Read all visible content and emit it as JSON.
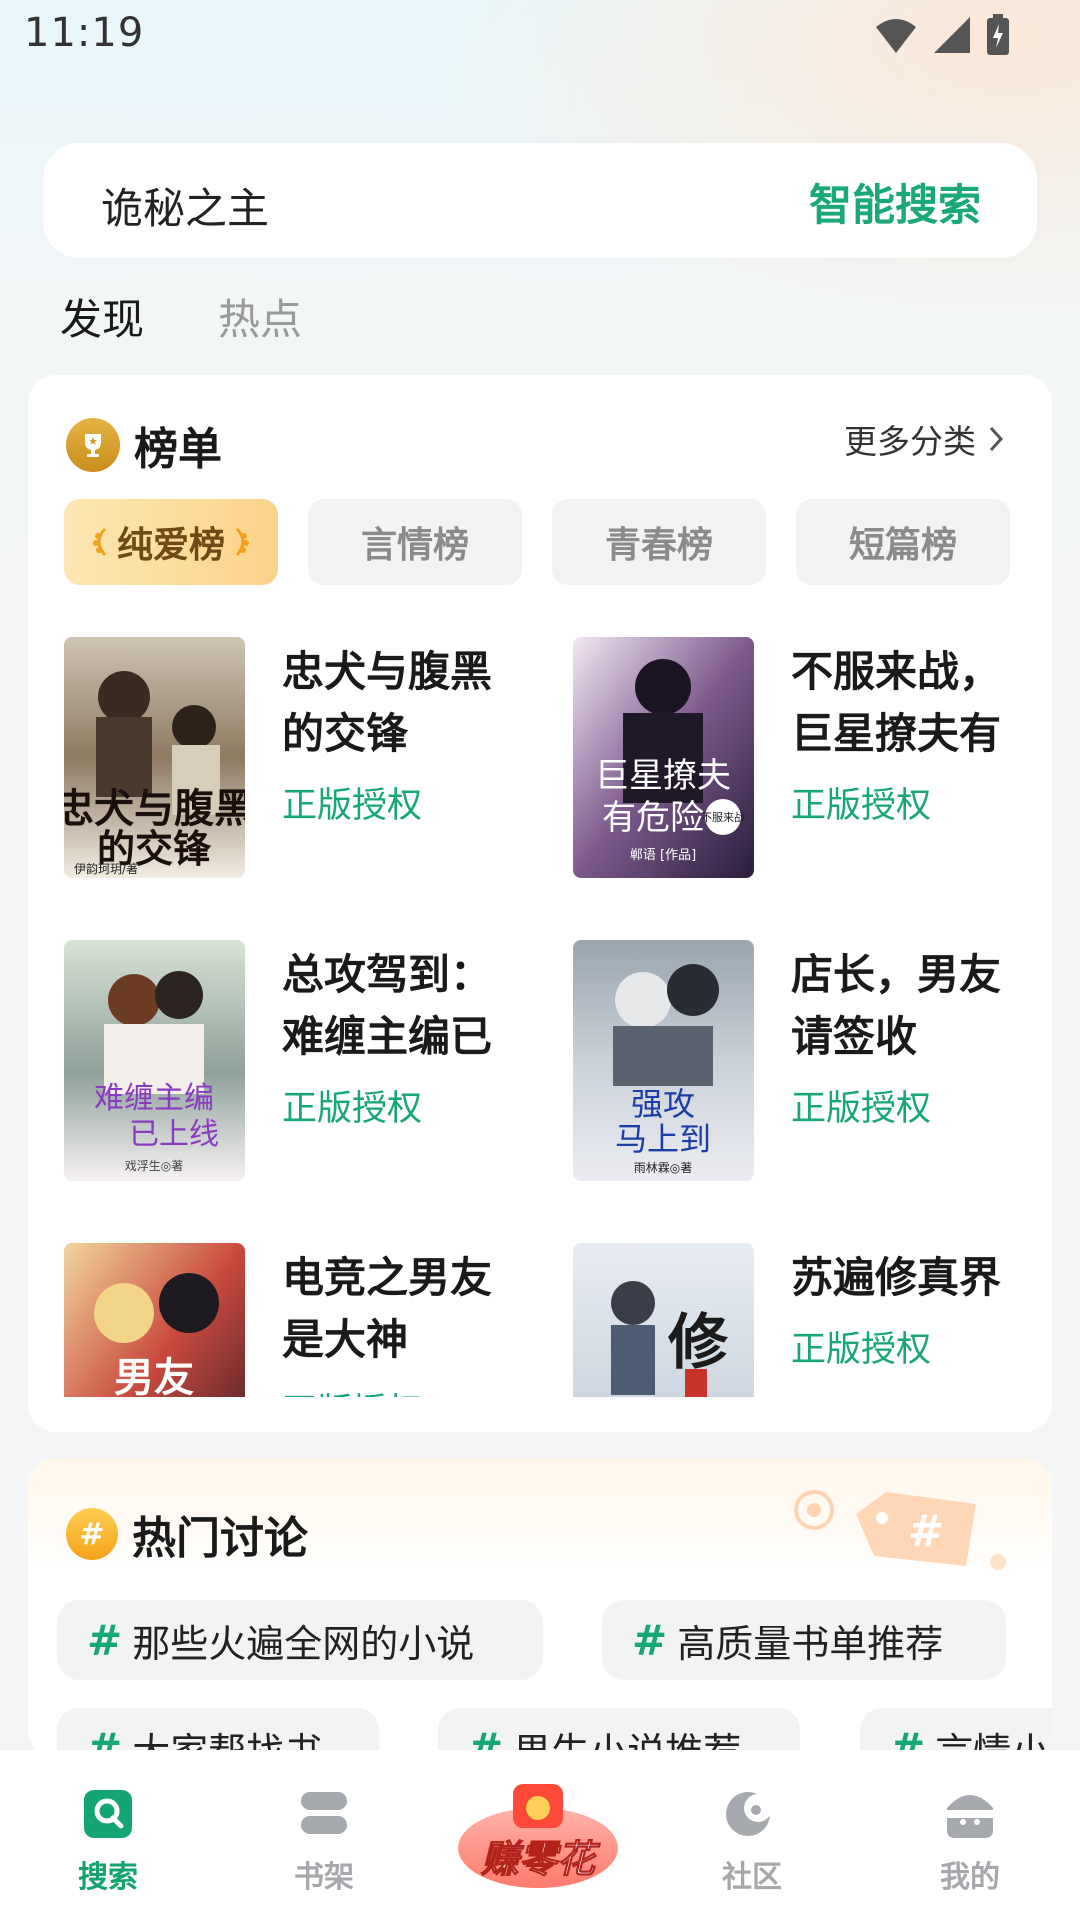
{
  "status_bar": {
    "time": "11:19"
  },
  "search": {
    "query": "诡秘之主",
    "ai_button": "智能搜索"
  },
  "top_tabs": [
    {
      "label": "发现",
      "active": true
    },
    {
      "label": "热点",
      "active": false
    }
  ],
  "ranking": {
    "title": "榜单",
    "more": "更多分类",
    "chips": [
      {
        "label": "纯爱榜",
        "active": true
      },
      {
        "label": "言情榜",
        "active": false
      },
      {
        "label": "青春榜",
        "active": false
      },
      {
        "label": "短篇榜",
        "active": false
      }
    ],
    "books": [
      {
        "title": "忠犬与腹黑的交锋",
        "badge": "正版授权",
        "cover_text": "忠犬与腹黑的交锋",
        "cover_author": "伊韵珂玥/著"
      },
      {
        "title": "不服来战，巨星撩夫有",
        "badge": "正版授权",
        "cover_text": "巨星撩夫有危险",
        "cover_author": "郸语 [作品]"
      },
      {
        "title": "总攻驾到：难缠主编已",
        "badge": "正版授权",
        "cover_text": "难缠主编已上线",
        "cover_author": "戏浮生◎著"
      },
      {
        "title": "店长，男友请签收",
        "badge": "正版授权",
        "cover_text": "强攻马上到",
        "cover_author": "雨林霖◎著"
      },
      {
        "title": "电竞之男友是大神",
        "badge": "正版授权",
        "cover_text": "男友",
        "cover_author": ""
      },
      {
        "title": "苏遍修真界",
        "badge": "正版授权",
        "cover_text": "修",
        "cover_author": ""
      }
    ]
  },
  "hot": {
    "title": "热门讨论",
    "topics": [
      "那些火遍全网的小说",
      "高质量书单推荐",
      "大家帮找书",
      "男生小说推荐",
      "言情小"
    ]
  },
  "bottom_nav": {
    "items": [
      {
        "label": "搜索",
        "active": true
      },
      {
        "label": "书架",
        "active": false
      },
      {
        "label": "赚零花",
        "active": false
      },
      {
        "label": "社区",
        "active": false
      },
      {
        "label": "我的",
        "active": false
      }
    ]
  },
  "colors": {
    "accent": "#16a678",
    "gold": "#e6b445",
    "orange": "#f6a21b"
  }
}
